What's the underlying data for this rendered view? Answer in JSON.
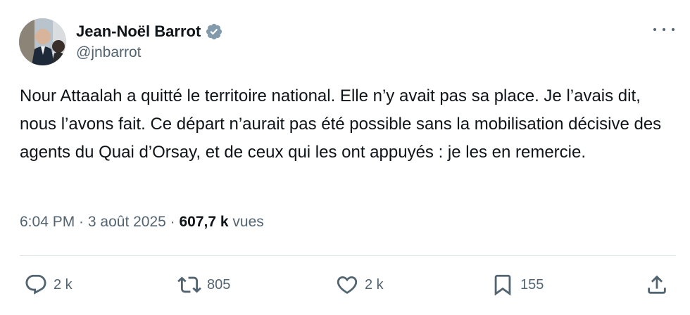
{
  "author": {
    "display_name": "Jean-Noël Barrot",
    "handle": "@jnbarrot",
    "verified_icon": "verified-badge-icon"
  },
  "tweet": {
    "text": "Nour Attaalah a quitté le territoire national. Elle n’y avait pas sa place. Je l’avais dit, nous l’avons fait. Ce départ n’aurait pas été possible sans la mobilisation décisive des agents du Quai d’Orsay, et de ceux qui les ont appuyés : je les en remercie.",
    "time": "6:04 PM",
    "separator": " · ",
    "date": "3 août 2025",
    "views_count": "607,7 k",
    "views_label": " vues"
  },
  "actions": {
    "replies": "2 k",
    "retweets": "805",
    "likes": "2 k",
    "bookmarks": "155"
  },
  "colors": {
    "text_primary": "#0f1419",
    "text_secondary": "#536471",
    "divider": "#e1e8ed"
  }
}
